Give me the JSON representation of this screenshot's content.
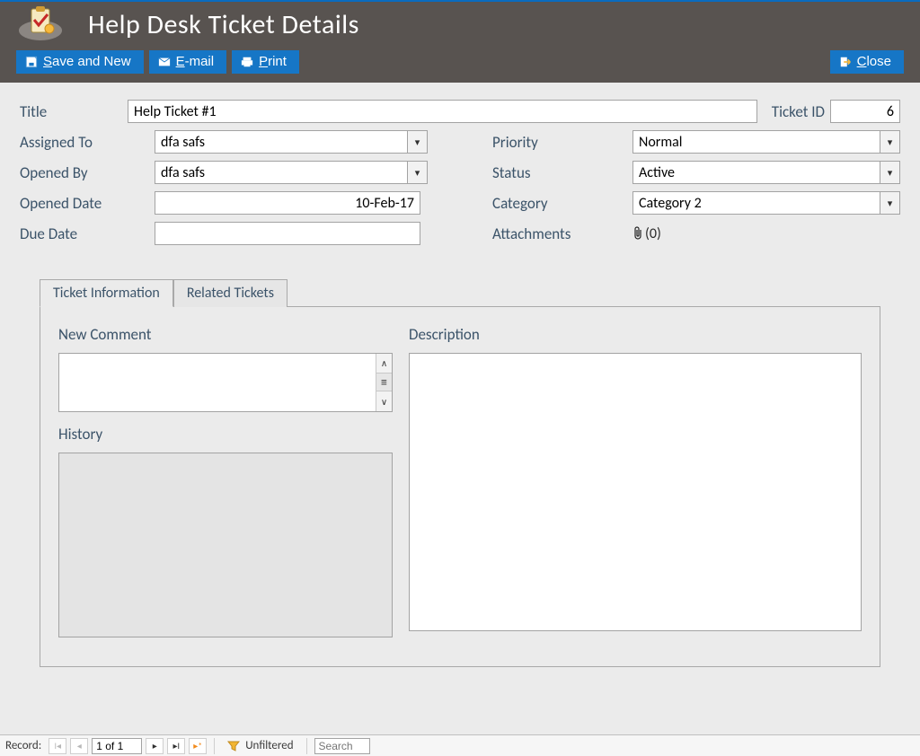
{
  "header": {
    "title": "Help Desk Ticket Details",
    "buttons": {
      "save_and_new": "Save and New",
      "save_and_new_ul": "S",
      "email": "E-mail",
      "email_ul": "E",
      "print": "Print",
      "print_ul": "P",
      "close": "Close",
      "close_ul": "C"
    }
  },
  "form": {
    "title_label": "Title",
    "title_value": "Help Ticket #1",
    "ticket_id_label": "Ticket ID",
    "ticket_id_value": "6",
    "assigned_to_label": "Assigned To",
    "assigned_to_value": "dfa safs",
    "opened_by_label": "Opened By",
    "opened_by_value": "dfa safs",
    "opened_date_label": "Opened Date",
    "opened_date_value": "10-Feb-17",
    "due_date_label": "Due Date",
    "due_date_value": "",
    "priority_label": "Priority",
    "priority_value": "Normal",
    "status_label": "Status",
    "status_value": "Active",
    "category_label": "Category",
    "category_value": "Category 2",
    "attachments_label": "Attachments",
    "attachments_count": "(0)"
  },
  "tabs": {
    "info": "Ticket Information",
    "related": "Related Tickets",
    "new_comment_label": "New Comment",
    "history_label": "History",
    "description_label": "Description"
  },
  "footer": {
    "record_label": "Record:",
    "record_value": "1 of 1",
    "filter_label": "Unfiltered",
    "search_placeholder": "Search"
  }
}
